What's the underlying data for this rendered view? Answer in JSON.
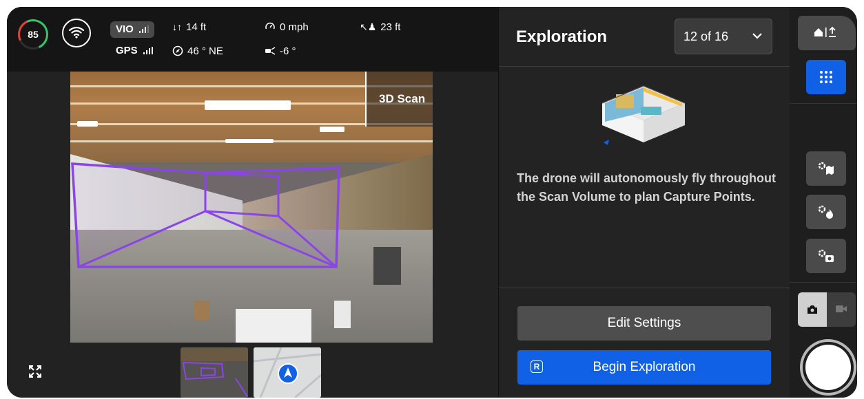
{
  "telemetry": {
    "battery": "85",
    "vio_label": "VIO",
    "gps_label": "GPS",
    "altitude": "14 ft",
    "heading": "46 ° NE",
    "speed": "0 mph",
    "pitch": "-6 °",
    "distance": "23 ft"
  },
  "camera": {
    "overlay_label": "3D Scan"
  },
  "panel": {
    "title": "Exploration",
    "page_select": "12 of 16",
    "description": "The drone will autonomously fly throughout the Scan Volume to plan Capture Points.",
    "edit_button": "Edit Settings",
    "begin_button": "Begin Exploration",
    "begin_key": "R"
  },
  "colors": {
    "accent": "#1161e6",
    "scan_volume": "#8a45e6",
    "battery_good": "#39c46a"
  },
  "toolbar": {
    "icons": [
      "home-return-icon",
      "grid-icon",
      "settings-map-icon",
      "settings-fire-icon",
      "settings-camera-icon",
      "photo-mode-icon",
      "video-mode-icon",
      "shutter-icon"
    ]
  }
}
